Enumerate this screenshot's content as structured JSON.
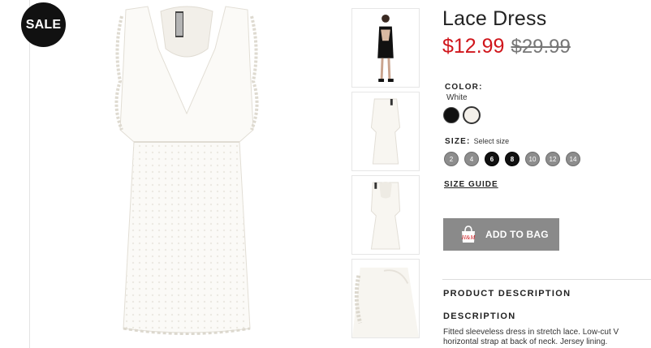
{
  "badge": {
    "sale": "SALE"
  },
  "product": {
    "title": "Lace Dress",
    "price_sale": "$12.99",
    "price_original": "$29.99"
  },
  "color": {
    "label": "COLOR:",
    "selected": "White",
    "swatches": [
      "black",
      "white"
    ]
  },
  "size": {
    "label": "SIZE:",
    "hint": "Select size",
    "options": [
      "2",
      "4",
      "6",
      "8",
      "10",
      "12",
      "14"
    ]
  },
  "size_guide": "SIZE GUIDE",
  "add_to_bag": {
    "label": "ADD TO BAG",
    "icon": "shopping-bag-icon"
  },
  "product_description": {
    "heading": "PRODUCT DESCRIPTION",
    "subheading": "DESCRIPTION",
    "line1": "Fitted sleeveless dress in stretch lace. Low-cut V",
    "line2": "horizontal strap at back of neck. Jersey lining."
  },
  "colors": {
    "sale_red": "#d0161c",
    "button_gray": "#8a8a8a",
    "badge_black": "#111111"
  }
}
